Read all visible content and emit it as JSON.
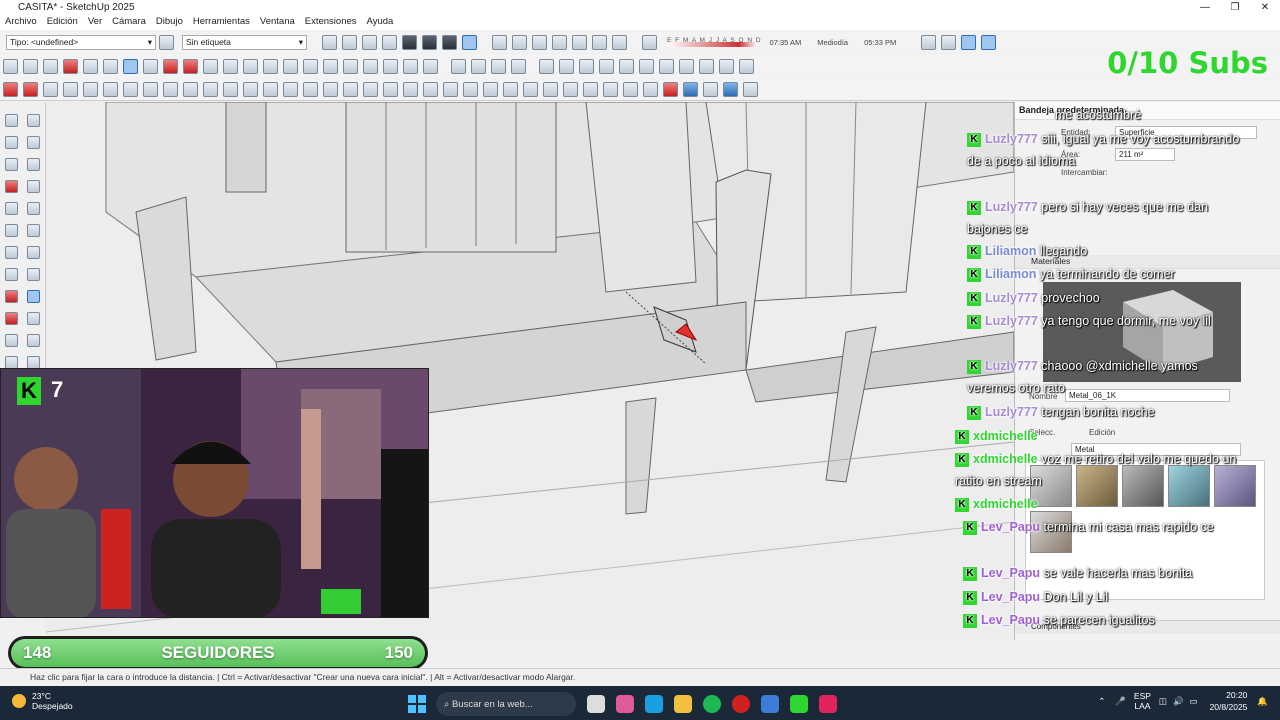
{
  "window": {
    "title": "CASITA* - SketchUp 2025",
    "controls": [
      "—",
      "❐",
      "✕"
    ]
  },
  "menu": [
    "Archivo",
    "Edición",
    "Ver",
    "Cámara",
    "Dibujo",
    "Herramientas",
    "Ventana",
    "Extensiones",
    "Ayuda"
  ],
  "toolbar": {
    "type_select": "Tipo: <undefined>",
    "tag_select": "Sin etiqueta",
    "months": "E F M A M J J A S O N D",
    "time_start": "07:35 AM",
    "time_mid": "Mediodía",
    "time_end": "05:33 PM"
  },
  "overlay": {
    "subs": "0/10 Subs"
  },
  "tray": {
    "title": "Bandeja predeterminada",
    "entity_label": "Entidad:",
    "entity_value": "Superficie",
    "area_label": "Área:",
    "area_value": "211 m²",
    "swap_label": "Intercambiar:",
    "materials_header": "Materiales",
    "name_label": "Nombre",
    "name_value": "Metal_06_1K",
    "select_tab": "Selecc.",
    "edit_tab": "Edición",
    "library": "Metal",
    "components_header": "Componentes"
  },
  "webcam": {
    "badge": "K",
    "count": "7"
  },
  "followers": {
    "current": "148",
    "label": "SEGUIDORES",
    "goal": "150"
  },
  "chat": [
    {
      "user": "",
      "text": "me acostumbré",
      "color": "#ffffff"
    },
    {
      "user": "Luzly777",
      "text": "siii, igual ya me voy acostumbrando de a poco al idioma",
      "color": "#a78bd6"
    },
    {
      "user": "Luzly777",
      "text": "pero si hay veces que me dan bajones ce",
      "color": "#a78bd6"
    },
    {
      "user": "Liliamon",
      "text": "llegando",
      "color": "#7a8bd6"
    },
    {
      "user": "Liliamon",
      "text": "ya terminando de comer",
      "color": "#7a8bd6"
    },
    {
      "user": "Luzly777",
      "text": "provechoo",
      "color": "#a78bd6"
    },
    {
      "user": "Luzly777",
      "text": "ya tengo que dormir, me voy lil",
      "color": "#a78bd6"
    },
    {
      "user": "Luzly777",
      "text": "chaooo @xdmichelle yamos veremos otro rato",
      "color": "#a78bd6"
    },
    {
      "user": "Luzly777",
      "text": "tengan bonita noche",
      "color": "#a78bd6"
    },
    {
      "user": "xdmichelle",
      "text": "",
      "color": "#2fd62f"
    },
    {
      "user": "xdmichelle",
      "text": "voz me retiro del valo me quedo un ratito en stream",
      "color": "#2fd62f"
    },
    {
      "user": "xdmichelle",
      "text": "",
      "color": "#2fd62f"
    },
    {
      "user": "Lev_Papu",
      "text": "termina mi casa mas rapido ce",
      "color": "#a061d6"
    },
    {
      "user": "Lev_Papu",
      "text": "se vale hacerla mas bonita",
      "color": "#a061d6"
    },
    {
      "user": "Lev_Papu",
      "text": "Don Lil y Lil",
      "color": "#a061d6"
    },
    {
      "user": "Lev_Papu",
      "text": "se parecen igualitos",
      "color": "#a061d6"
    }
  ],
  "status": {
    "text": "Haz clic para fijar la cara o introduce la distancia. | Ctrl = Activar/desactivar \"Crear una nueva cara inicial\". | Alt = Activar/desactivar modo Alargar."
  },
  "taskbar": {
    "temp": "23°C",
    "weather": "Despejado",
    "search": "Buscar en la web...",
    "lang1": "ESP",
    "lang2": "LAA",
    "time": "20:20",
    "date": "20/8/2025"
  },
  "colors": {
    "accent_green": "#2fd62f",
    "taskbar": "#1b2838"
  }
}
